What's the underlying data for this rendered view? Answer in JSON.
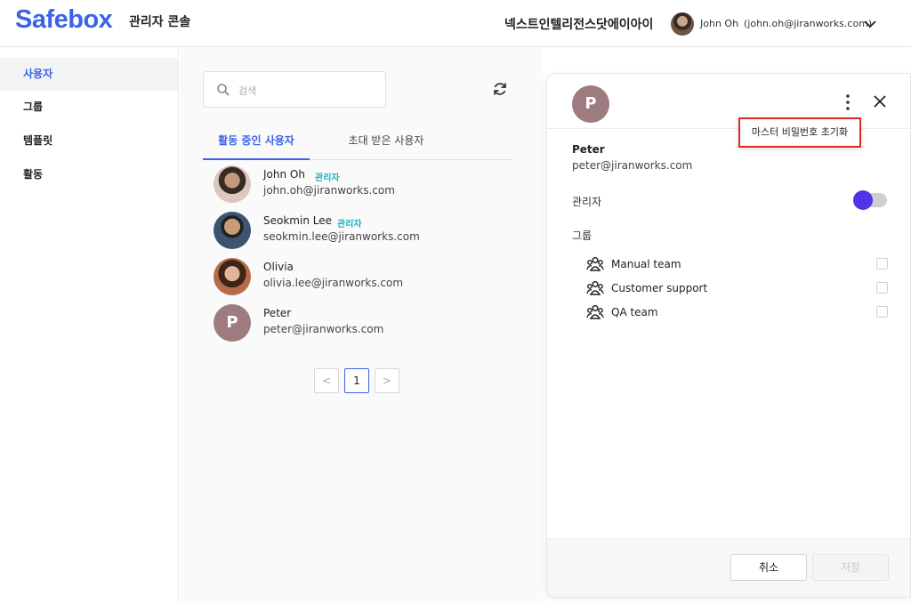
{
  "header": {
    "logo": "Safebox",
    "console_title": "관리자 콘솔",
    "org_name": "넥스트인텔리전스닷에이아이",
    "user_name": "John Oh",
    "user_email": "(john.oh@jiranworks.com)"
  },
  "sidebar": {
    "items": [
      {
        "label": "사용자",
        "active": true
      },
      {
        "label": "그룹",
        "active": false
      },
      {
        "label": "템플릿",
        "active": false
      },
      {
        "label": "활동",
        "active": false
      }
    ]
  },
  "search": {
    "placeholder": "검색"
  },
  "tabs": [
    {
      "label": "활동 중인 사용자",
      "active": true
    },
    {
      "label": "초대 받은 사용자",
      "active": false
    }
  ],
  "users": [
    {
      "name": "John Oh",
      "badge": "관리자",
      "email": "john.oh@jiranworks.com"
    },
    {
      "name": "Seokmin Lee",
      "badge": "관리자",
      "email": "seokmin.lee@jiranworks.com"
    },
    {
      "name": "Olivia",
      "badge": "",
      "email": "olivia.lee@jiranworks.com"
    },
    {
      "name": "Peter",
      "badge": "",
      "email": "peter@jiranworks.com",
      "initial": "P"
    }
  ],
  "pagination": {
    "current": "1",
    "prev": "<",
    "next": ">"
  },
  "detail": {
    "initial": "P",
    "name": "Peter",
    "email": "peter@jiranworks.com",
    "admin_label": "관리자",
    "admin_toggle_on": false,
    "group_label": "그룹",
    "groups": [
      {
        "name": "Manual team",
        "checked": false
      },
      {
        "name": "Customer support",
        "checked": false
      },
      {
        "name": "QA team",
        "checked": false
      }
    ],
    "cancel_label": "취소",
    "save_label": "저장"
  },
  "menu": {
    "reset_master_password": "마스터 비밀번호 초기화"
  },
  "colors": {
    "brand": "#3b63e8",
    "admin_badge": "#1cb3c4",
    "toggle_knob": "#4f35e6",
    "highlight": "#e02b20"
  }
}
